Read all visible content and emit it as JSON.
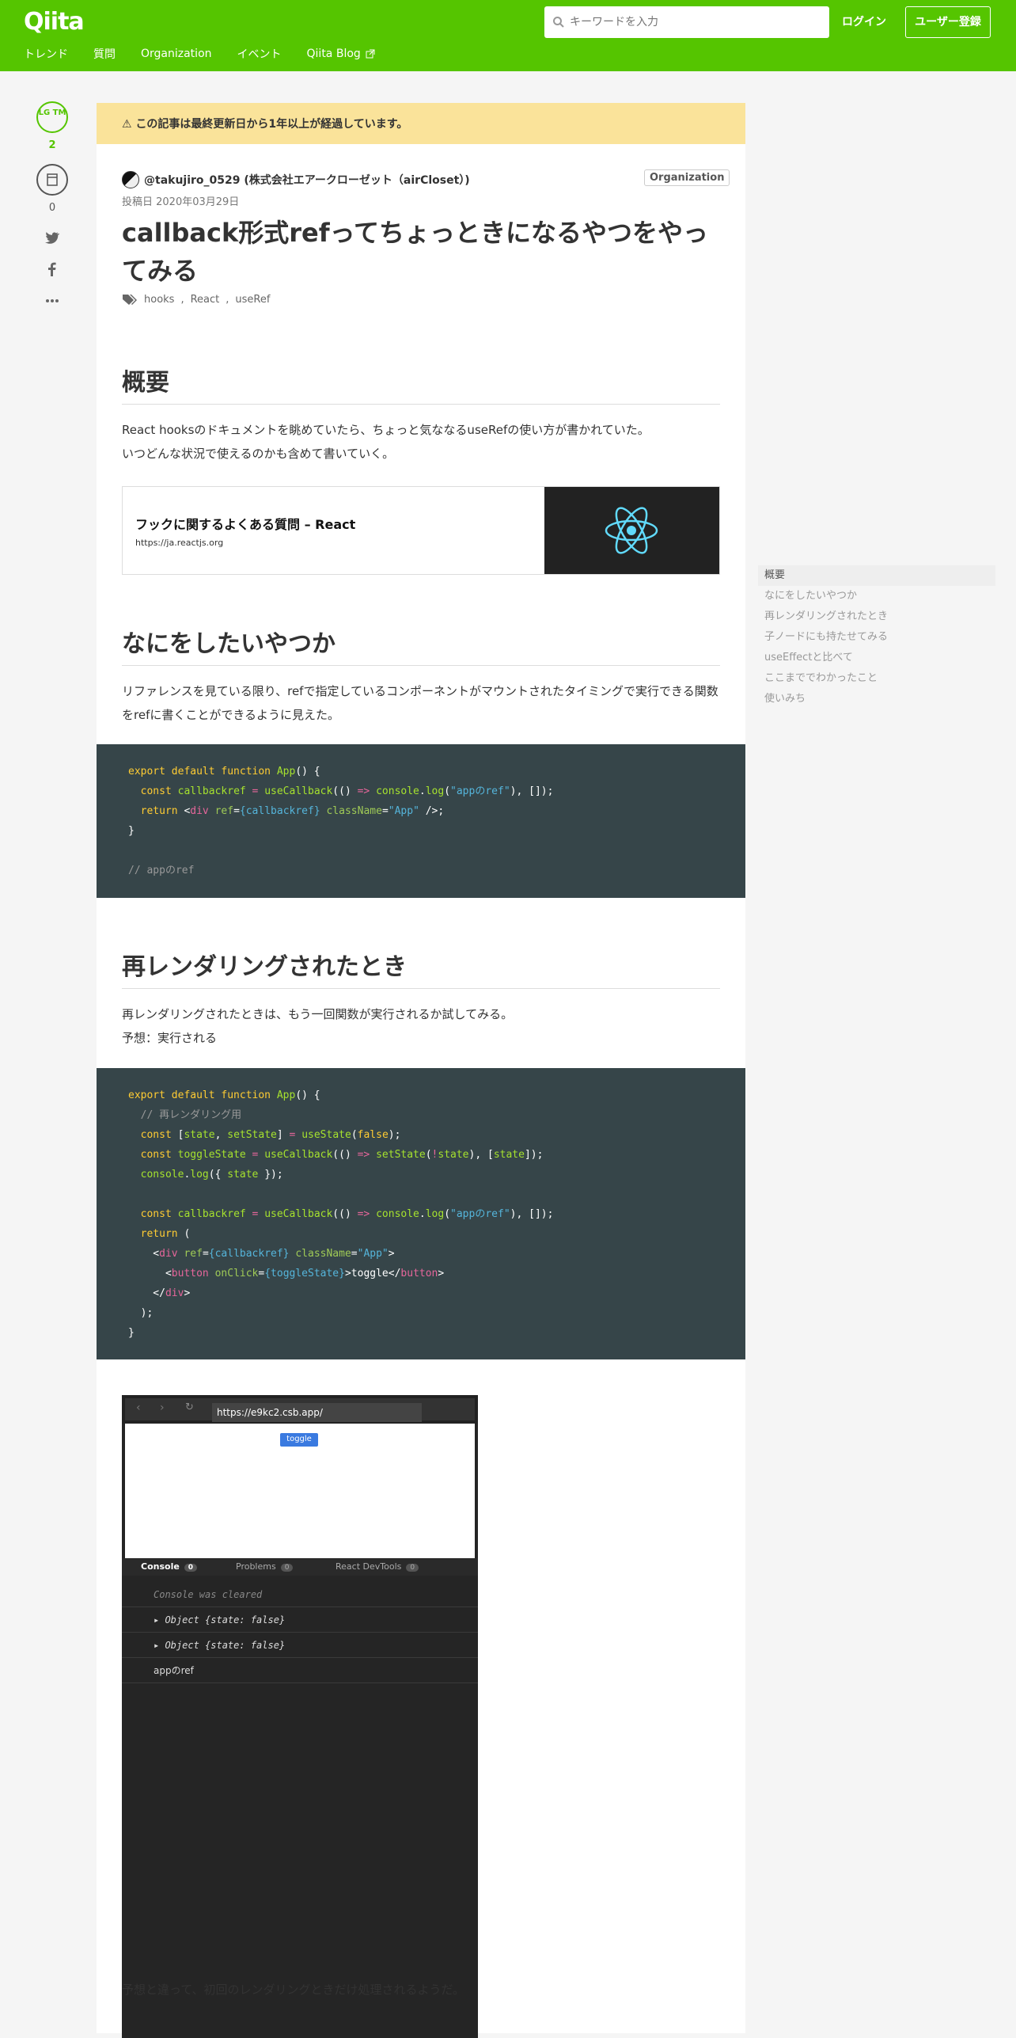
{
  "header": {
    "logo": "Qiita",
    "search_placeholder": "キーワードを入力",
    "login": "ログイン",
    "signup": "ユーザー登録",
    "nav": [
      "トレンド",
      "質問",
      "Organization",
      "イベント",
      "Qiita Blog"
    ]
  },
  "side": {
    "lgtm_label": "LG TM",
    "lgtm_count": "2",
    "stock_count": "0"
  },
  "article": {
    "warning": "この記事は最終更新日から1年以上が経過しています。",
    "author": "@takujiro_0529 (株式会社エアークローゼット（airCloset）)",
    "org_badge": "Organization",
    "posted": "投稿日 2020年03月29日",
    "title": "callback形式refってちょっときになるやつをやってみる",
    "tags": [
      "hooks",
      "React",
      "useRef"
    ],
    "s1_title": "概要",
    "s1_p1": "React hooksのドキュメントを眺めていたら、ちょっと気ななるuseRefの使い方が書かれていた。",
    "s1_p2": "いつどんな状況で使えるのかも含めて書いていく。",
    "card_title": "フックに関するよくある質問 – React",
    "card_url": "https://ja.reactjs.org",
    "s2_title": "なにをしたいやつか",
    "s2_p": "リファレンスを見ている限り、refで指定しているコンポーネントがマウントされたタイミングで実行できる関数をrefに書くことができるように見えた。",
    "code1_comment": "// appのref",
    "s3_title": "再レンダリングされたとき",
    "s3_p1": "再レンダリングされたときは、もう一回関数が実行されるか試してみる。",
    "s3_p2": "予想：実行される",
    "s4_p": "予想と違って、初回のレンダリングときだけ処理されるようだ。"
  },
  "screenshot": {
    "url": "https://e9kc2.csb.app/",
    "toggle": "toggle",
    "tabs": [
      {
        "label": "Console",
        "count": "0"
      },
      {
        "label": "Problems",
        "count": "0"
      },
      {
        "label": "React DevTools",
        "count": "0"
      }
    ],
    "cleared": "Console was cleared",
    "obj1": "▸ Object {state: false}",
    "obj2": "▸ Object {state: false}",
    "ref": "appのref"
  },
  "toc": [
    "概要",
    "なにをしたいやつか",
    "再レンダリングされたとき",
    "子ノードにも持たせてみる",
    "useEffectと比べて",
    "ここまででわかったこと",
    "使いみち"
  ]
}
